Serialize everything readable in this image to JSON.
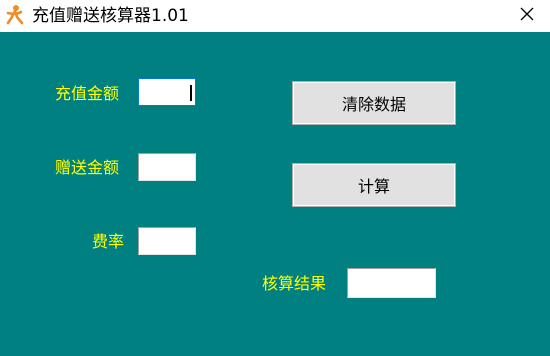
{
  "window": {
    "title": "充值赠送核算器1.01"
  },
  "form": {
    "recharge_label": "充值金额",
    "recharge_value": "",
    "gift_label": "赠送金额",
    "gift_value": "",
    "rate_label": "费率",
    "rate_value": "",
    "result_label": "核算结果",
    "result_value": ""
  },
  "buttons": {
    "clear_label": "清除数据",
    "calculate_label": "计算"
  },
  "colors": {
    "client_background": "#008080",
    "label_color": "#ffff00",
    "icon_color": "#f08c28"
  }
}
